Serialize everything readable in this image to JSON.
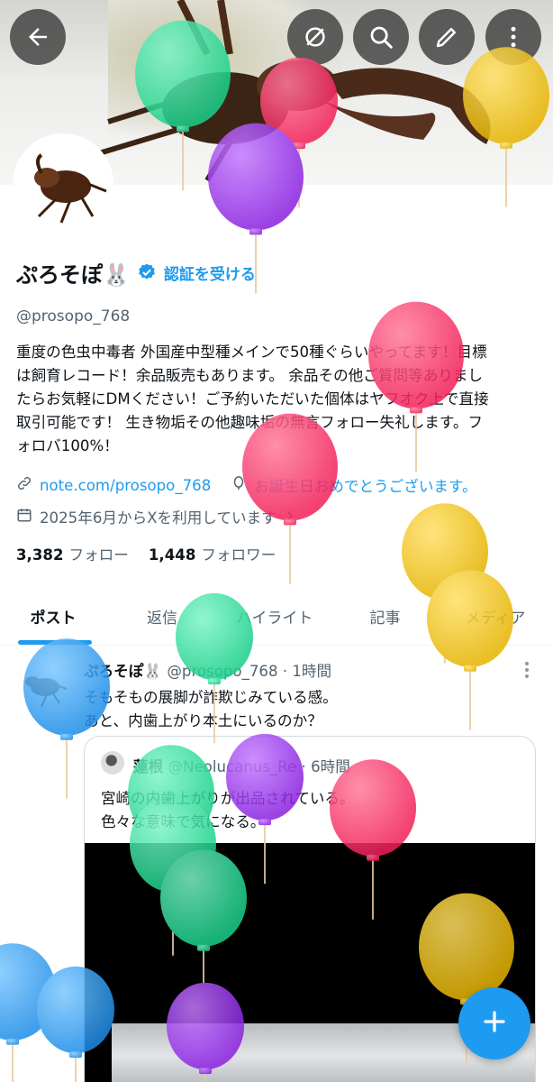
{
  "header": {
    "back_icon": "arrow-left-icon",
    "actions": [
      "no-wifi-icon",
      "search-icon",
      "edit-pen-icon",
      "more-vertical-icon"
    ]
  },
  "profile": {
    "display_name": "ぷろそぽ🐰",
    "verify_label": "認証を受ける",
    "handle": "@prosopo_768",
    "bio_lines": [
      "重度の色虫中毒者 外国産中型種メインで50種ぐらいやってます！目標",
      "は飼育レコード！余品販売もあります。 余品その他ご質問等ありまし",
      "たらお気軽にDMください！ご予約いただいた個体はヤフオク上で直接",
      "取引可能です！ 生き物垢その他趣味垢の無言フォロー失礼します。フ",
      "ォロバ100%！"
    ],
    "link": "note.com/prosopo_768",
    "birthday": "お誕生日おめでとうございます。",
    "joined": "2025年6月からXを利用しています",
    "following_count": "3,382",
    "following_label": "フォロー",
    "followers_count": "1,448",
    "followers_label": "フォロワー"
  },
  "tabs": [
    "ポスト",
    "返信",
    "ハイライト",
    "記事",
    "メディア"
  ],
  "tweet": {
    "name": "ぷろそぽ🐰",
    "handle": "@prosopo_768",
    "time": "· 1時間",
    "lines": [
      "そもそもの展脚が詐欺じみている感。",
      "あと、内歯上がり本土にいるのか？"
    ],
    "quote": {
      "name": "蓮根",
      "handle": "@Neolucanus_Re",
      "time": "· 6時間",
      "lines": [
        "宮崎の内歯上がりが出品されている。",
        "色々な意味で気になる。"
      ]
    }
  },
  "fab_icon": "plus-icon",
  "colors": {
    "accent": "#1d9bf0",
    "balloon_green": "#2fe3a1",
    "balloon_pink": "#ff3d6e",
    "balloon_purple": "#a03cf0",
    "balloon_yellow": "#f5c518",
    "balloon_blue": "#3fa9f5"
  }
}
